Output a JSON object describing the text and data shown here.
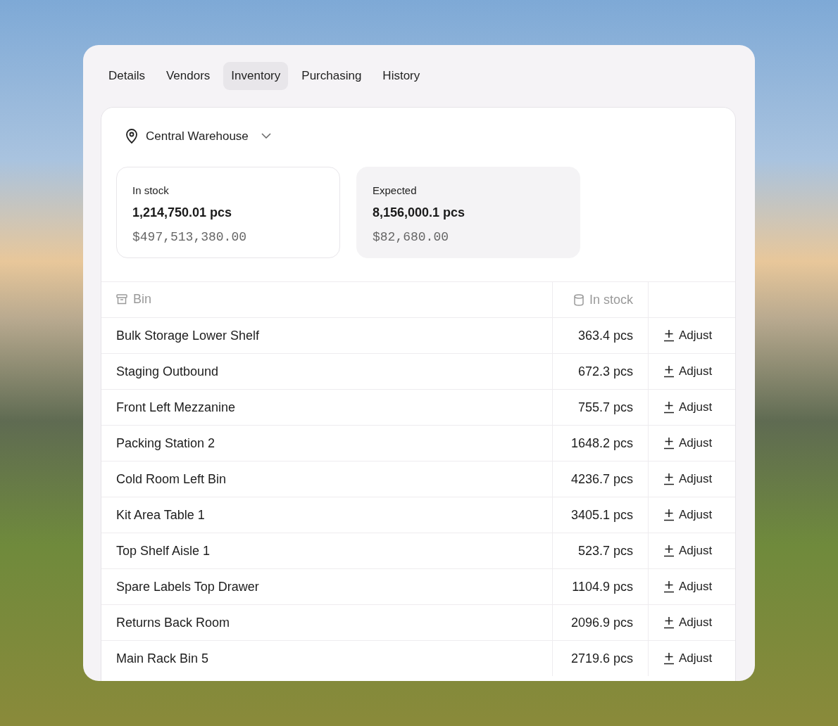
{
  "tabs": [
    {
      "label": "Details",
      "selected": false
    },
    {
      "label": "Vendors",
      "selected": false
    },
    {
      "label": "Inventory",
      "selected": true
    },
    {
      "label": "Purchasing",
      "selected": false
    },
    {
      "label": "History",
      "selected": false
    }
  ],
  "location": {
    "label": "Central Warehouse"
  },
  "stats": [
    {
      "label": "In stock",
      "quantity": "1,214,750.01 pcs",
      "value": "$497,513,380.00",
      "selected": true
    },
    {
      "label": "Expected",
      "quantity": "8,156,000.1 pcs",
      "value": "$82,680.00",
      "selected": false
    }
  ],
  "table": {
    "columns": [
      "Bin",
      "In stock"
    ],
    "rows": [
      {
        "bin": "Bulk Storage Lower Shelf",
        "stock": "363.4 pcs",
        "action": "Adjust"
      },
      {
        "bin": "Staging Outbound",
        "stock": "672.3 pcs",
        "action": "Adjust"
      },
      {
        "bin": "Front Left Mezzanine",
        "stock": "755.7 pcs",
        "action": "Adjust"
      },
      {
        "bin": "Packing Station 2",
        "stock": "1648.2 pcs",
        "action": "Adjust"
      },
      {
        "bin": "Cold Room Left Bin",
        "stock": "4236.7 pcs",
        "action": "Adjust"
      },
      {
        "bin": "Kit Area Table 1",
        "stock": "3405.1 pcs",
        "action": "Adjust"
      },
      {
        "bin": "Top Shelf Aisle 1",
        "stock": "523.7 pcs",
        "action": "Adjust"
      },
      {
        "bin": "Spare Labels Top Drawer",
        "stock": "1104.9 pcs",
        "action": "Adjust"
      },
      {
        "bin": "Returns Back Room",
        "stock": "2096.9 pcs",
        "action": "Adjust"
      },
      {
        "bin": "Main Rack Bin 5",
        "stock": "2719.6 pcs",
        "action": "Adjust"
      }
    ]
  }
}
